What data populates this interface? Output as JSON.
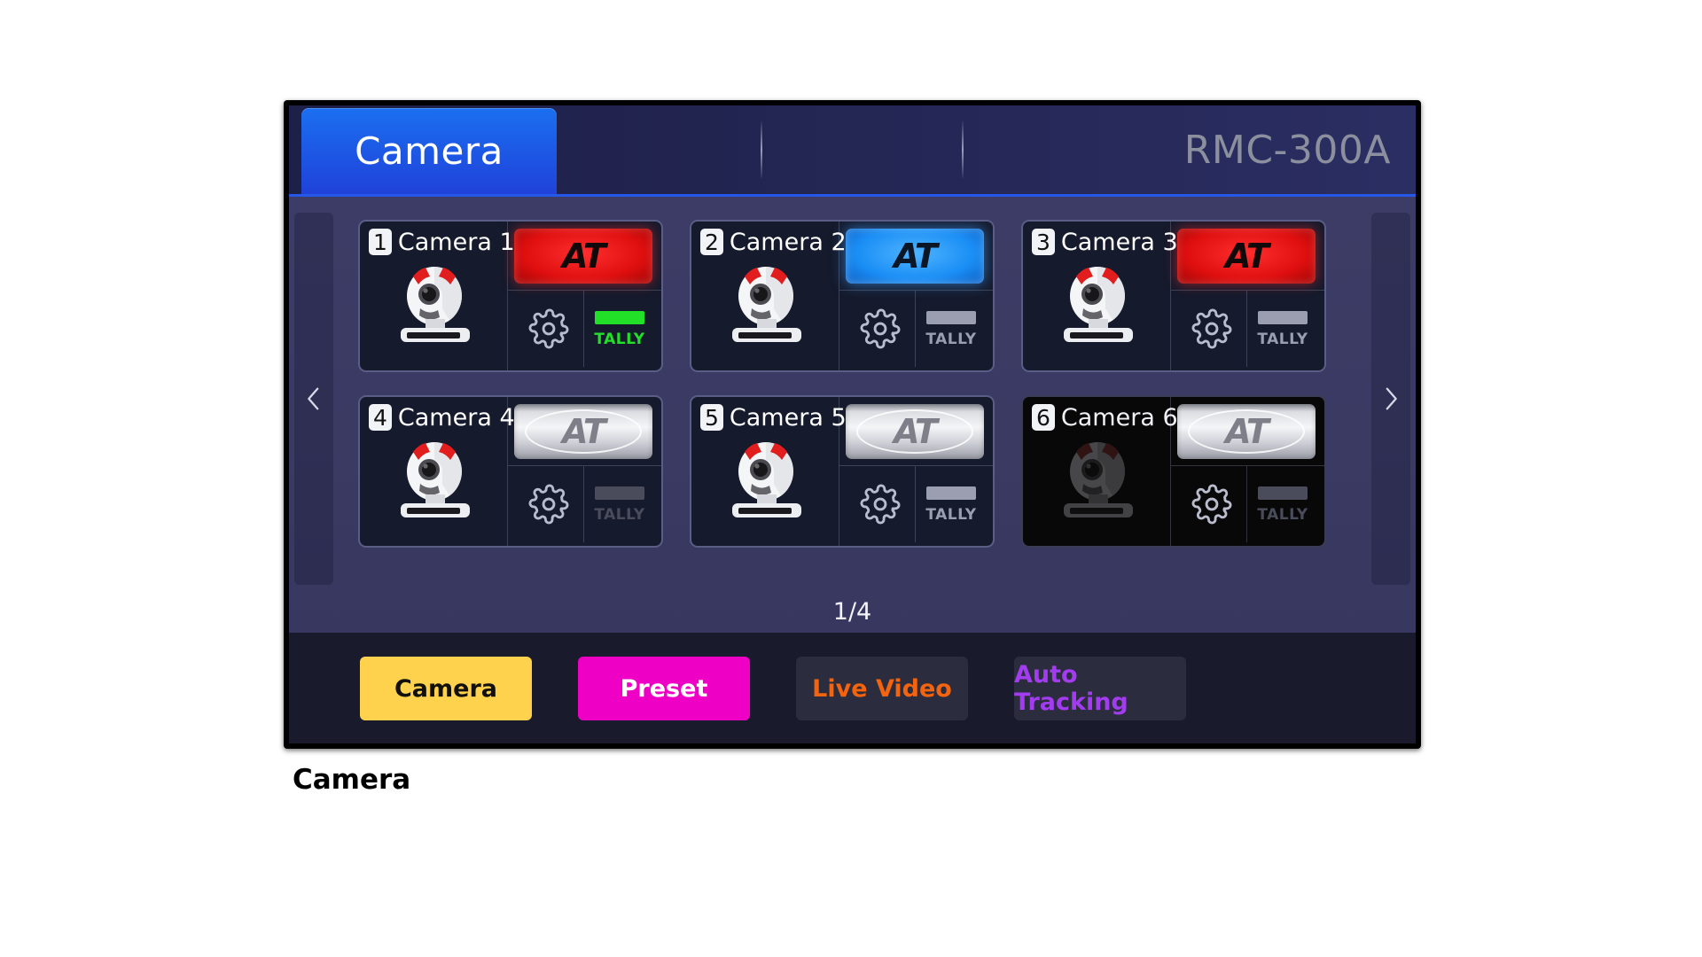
{
  "caption": "Camera",
  "header": {
    "active_tab": "Camera",
    "device_name": "RMC-300A"
  },
  "nav": {
    "prev_icon": "chevron-left-icon",
    "next_icon": "chevron-right-icon",
    "page_indicator": "1/4"
  },
  "colors": {
    "tab_active": "#1d56e4",
    "at_red": "#e00f0f",
    "at_blue": "#1a8ef5",
    "at_silver": "#f4f5f7",
    "tally_on": "#22e027",
    "tally_off": "#9a9eb0",
    "btn_camera": "#ffd24d",
    "btn_preset": "#ee00c4",
    "btn_live_video_text": "#f4630d",
    "btn_auto_tracking_text": "#a33cf0"
  },
  "cameras": [
    {
      "number": "1",
      "name": "Camera 1",
      "at_label": "AT",
      "at_state": "red",
      "tally_label": "TALLY",
      "tally_state": "on",
      "online": true,
      "gear_icon": "gear-icon"
    },
    {
      "number": "2",
      "name": "Camera 2",
      "at_label": "AT",
      "at_state": "blue",
      "tally_label": "TALLY",
      "tally_state": "off",
      "online": true,
      "gear_icon": "gear-icon"
    },
    {
      "number": "3",
      "name": "Camera 3",
      "at_label": "AT",
      "at_state": "red",
      "tally_label": "TALLY",
      "tally_state": "off",
      "online": true,
      "gear_icon": "gear-icon"
    },
    {
      "number": "4",
      "name": "Camera 4",
      "at_label": "AT",
      "at_state": "silver",
      "tally_label": "TALLY",
      "tally_state": "dim",
      "online": true,
      "gear_icon": "gear-icon"
    },
    {
      "number": "5",
      "name": "Camera 5",
      "at_label": "AT",
      "at_state": "silver",
      "tally_label": "TALLY",
      "tally_state": "off",
      "online": true,
      "gear_icon": "gear-icon"
    },
    {
      "number": "6",
      "name": "Camera 6",
      "at_label": "AT",
      "at_state": "silver",
      "tally_label": "TALLY",
      "tally_state": "dim",
      "online": false,
      "gear_icon": "gear-icon"
    }
  ],
  "footer": {
    "buttons": [
      {
        "label": "Camera"
      },
      {
        "label": "Preset"
      },
      {
        "label": "Live Video"
      },
      {
        "label": "Auto Tracking"
      }
    ]
  }
}
